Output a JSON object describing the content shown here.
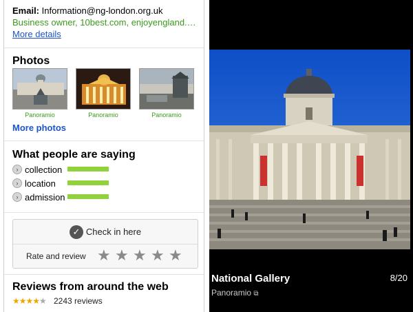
{
  "left": {
    "email_label": "Email:",
    "email_value": "Information@ng-london.org.uk",
    "owner_line": "Business owner, 10best.com, enjoyengland.co...",
    "more_details": "More details",
    "photos": {
      "title": "Photos",
      "captions": [
        "Panoramio",
        "Panoramio",
        "Panoramio"
      ],
      "more_photos": "More photos"
    },
    "people": {
      "title": "What people are saying",
      "items": [
        {
          "label": "collection",
          "level": 1.0
        },
        {
          "label": "location",
          "level": 1.0
        },
        {
          "label": "admission",
          "level": 1.0
        }
      ]
    },
    "actions": {
      "checkin": "Check in here",
      "rate": "Rate and review",
      "stars": [
        "★",
        "★",
        "★",
        "★",
        "★"
      ]
    },
    "reviews": {
      "title": "Reviews from around the web",
      "rating_stars": "★★★★",
      "rating_empty": "★",
      "count": "2243 reviews"
    }
  },
  "right": {
    "title": "National Gallery",
    "source": "Panoramio",
    "counter": "8/20"
  },
  "colors": {
    "link": "#1a55c6",
    "green_text": "#3a9b1a",
    "bar_green": "#8fd23c",
    "sky_blue": "#1a5fd0"
  }
}
